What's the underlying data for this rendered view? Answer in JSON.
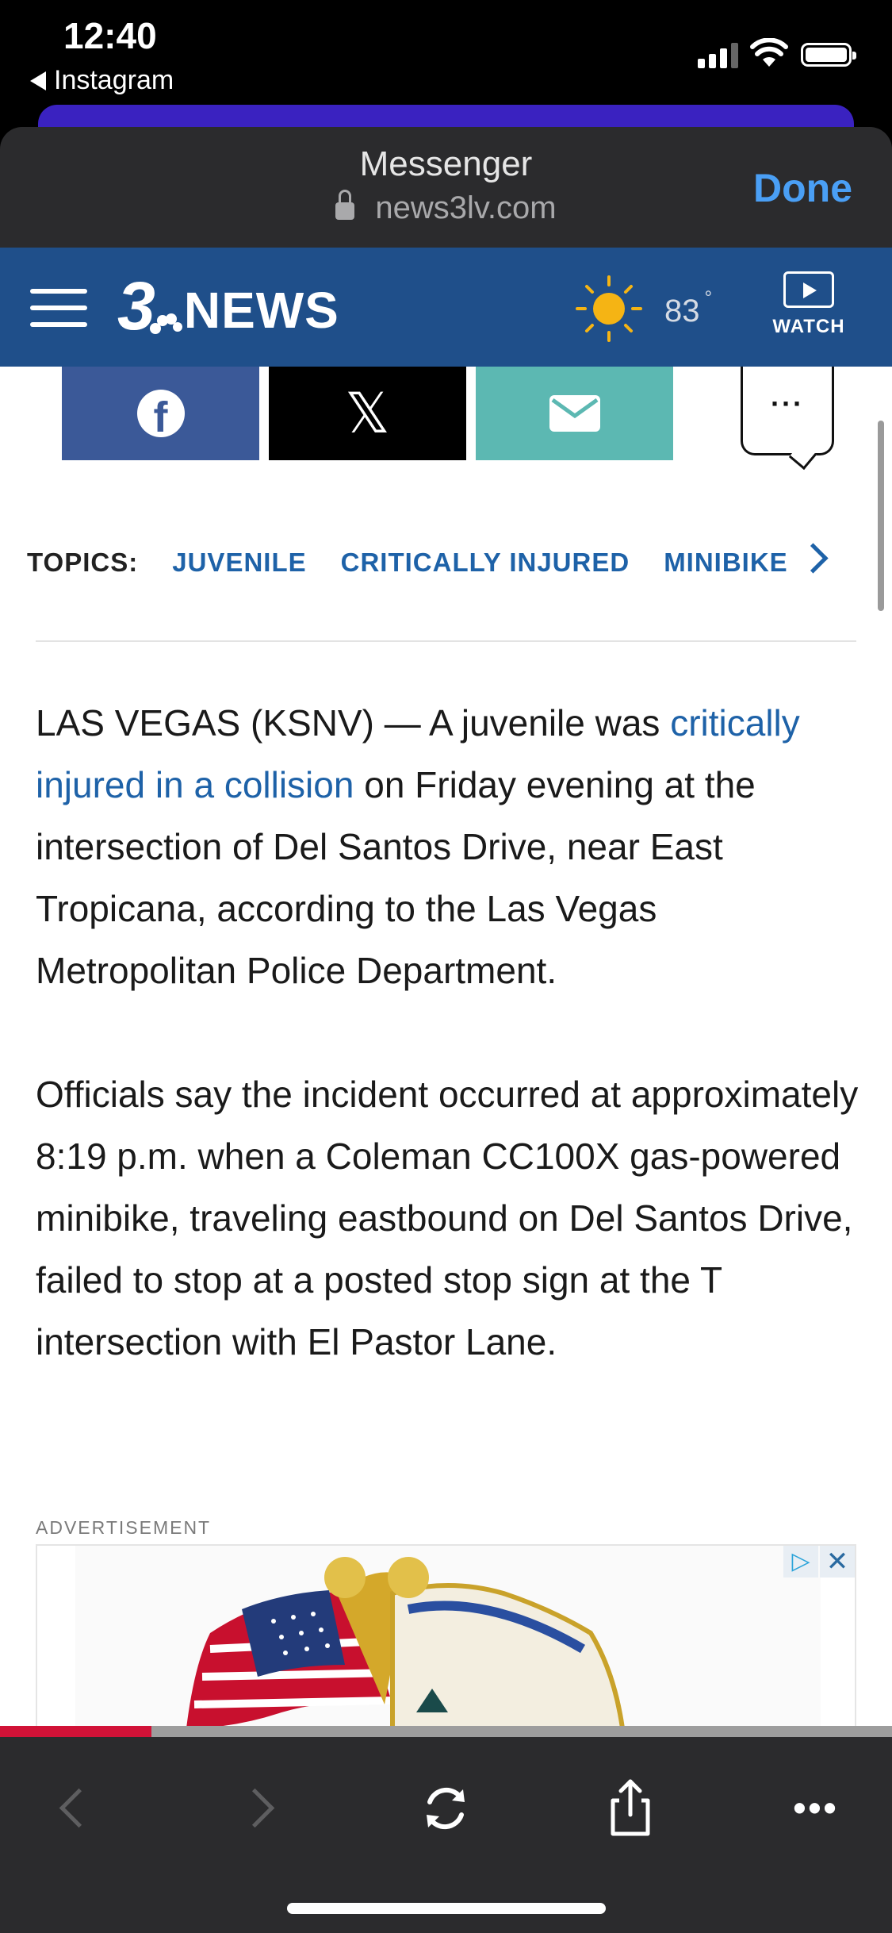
{
  "status_bar": {
    "time": "12:40",
    "back_app": "Instagram"
  },
  "sheet": {
    "title": "Messenger",
    "url": "news3lv.com",
    "done_label": "Done"
  },
  "site_header": {
    "logo_number": "3",
    "logo_text": "NEWS",
    "temperature": "83",
    "degree_symbol": "°",
    "watch_label": "WATCH"
  },
  "share_bar": {
    "facebook_glyph": "f",
    "x_glyph": "𝕏",
    "more_glyph": "···"
  },
  "topics": {
    "label": "TOPICS:",
    "items": [
      "JUVENILE",
      "CRITICALLY INJURED",
      "MINIBIKE"
    ]
  },
  "article": {
    "p1_pre": "LAS VEGAS (KSNV) — A juvenile was ",
    "p1_link": "critically injured in a collision",
    "p1_post": " on Friday evening at the intersection of Del Santos Drive, near East Tropicana, according to the Las Vegas Metropolitan Police Department.",
    "p2": "Officials say the incident occurred at approximately 8:19 p.m. when a Coleman CC100X gas-powered minibike, traveling eastbound on Del Santos Drive, failed to stop at a posted stop sign at the T intersection with El Pastor Lane."
  },
  "advertisement": {
    "label": "ADVERTISEMENT",
    "adchoices_glyph": "▷",
    "close_glyph": "✕"
  },
  "reading_progress": 0.17,
  "colors": {
    "brand_navy": "#1f4f8a",
    "link_blue": "#1e62a8",
    "done_blue": "#4a9ff5",
    "progress_red": "#d11237"
  }
}
